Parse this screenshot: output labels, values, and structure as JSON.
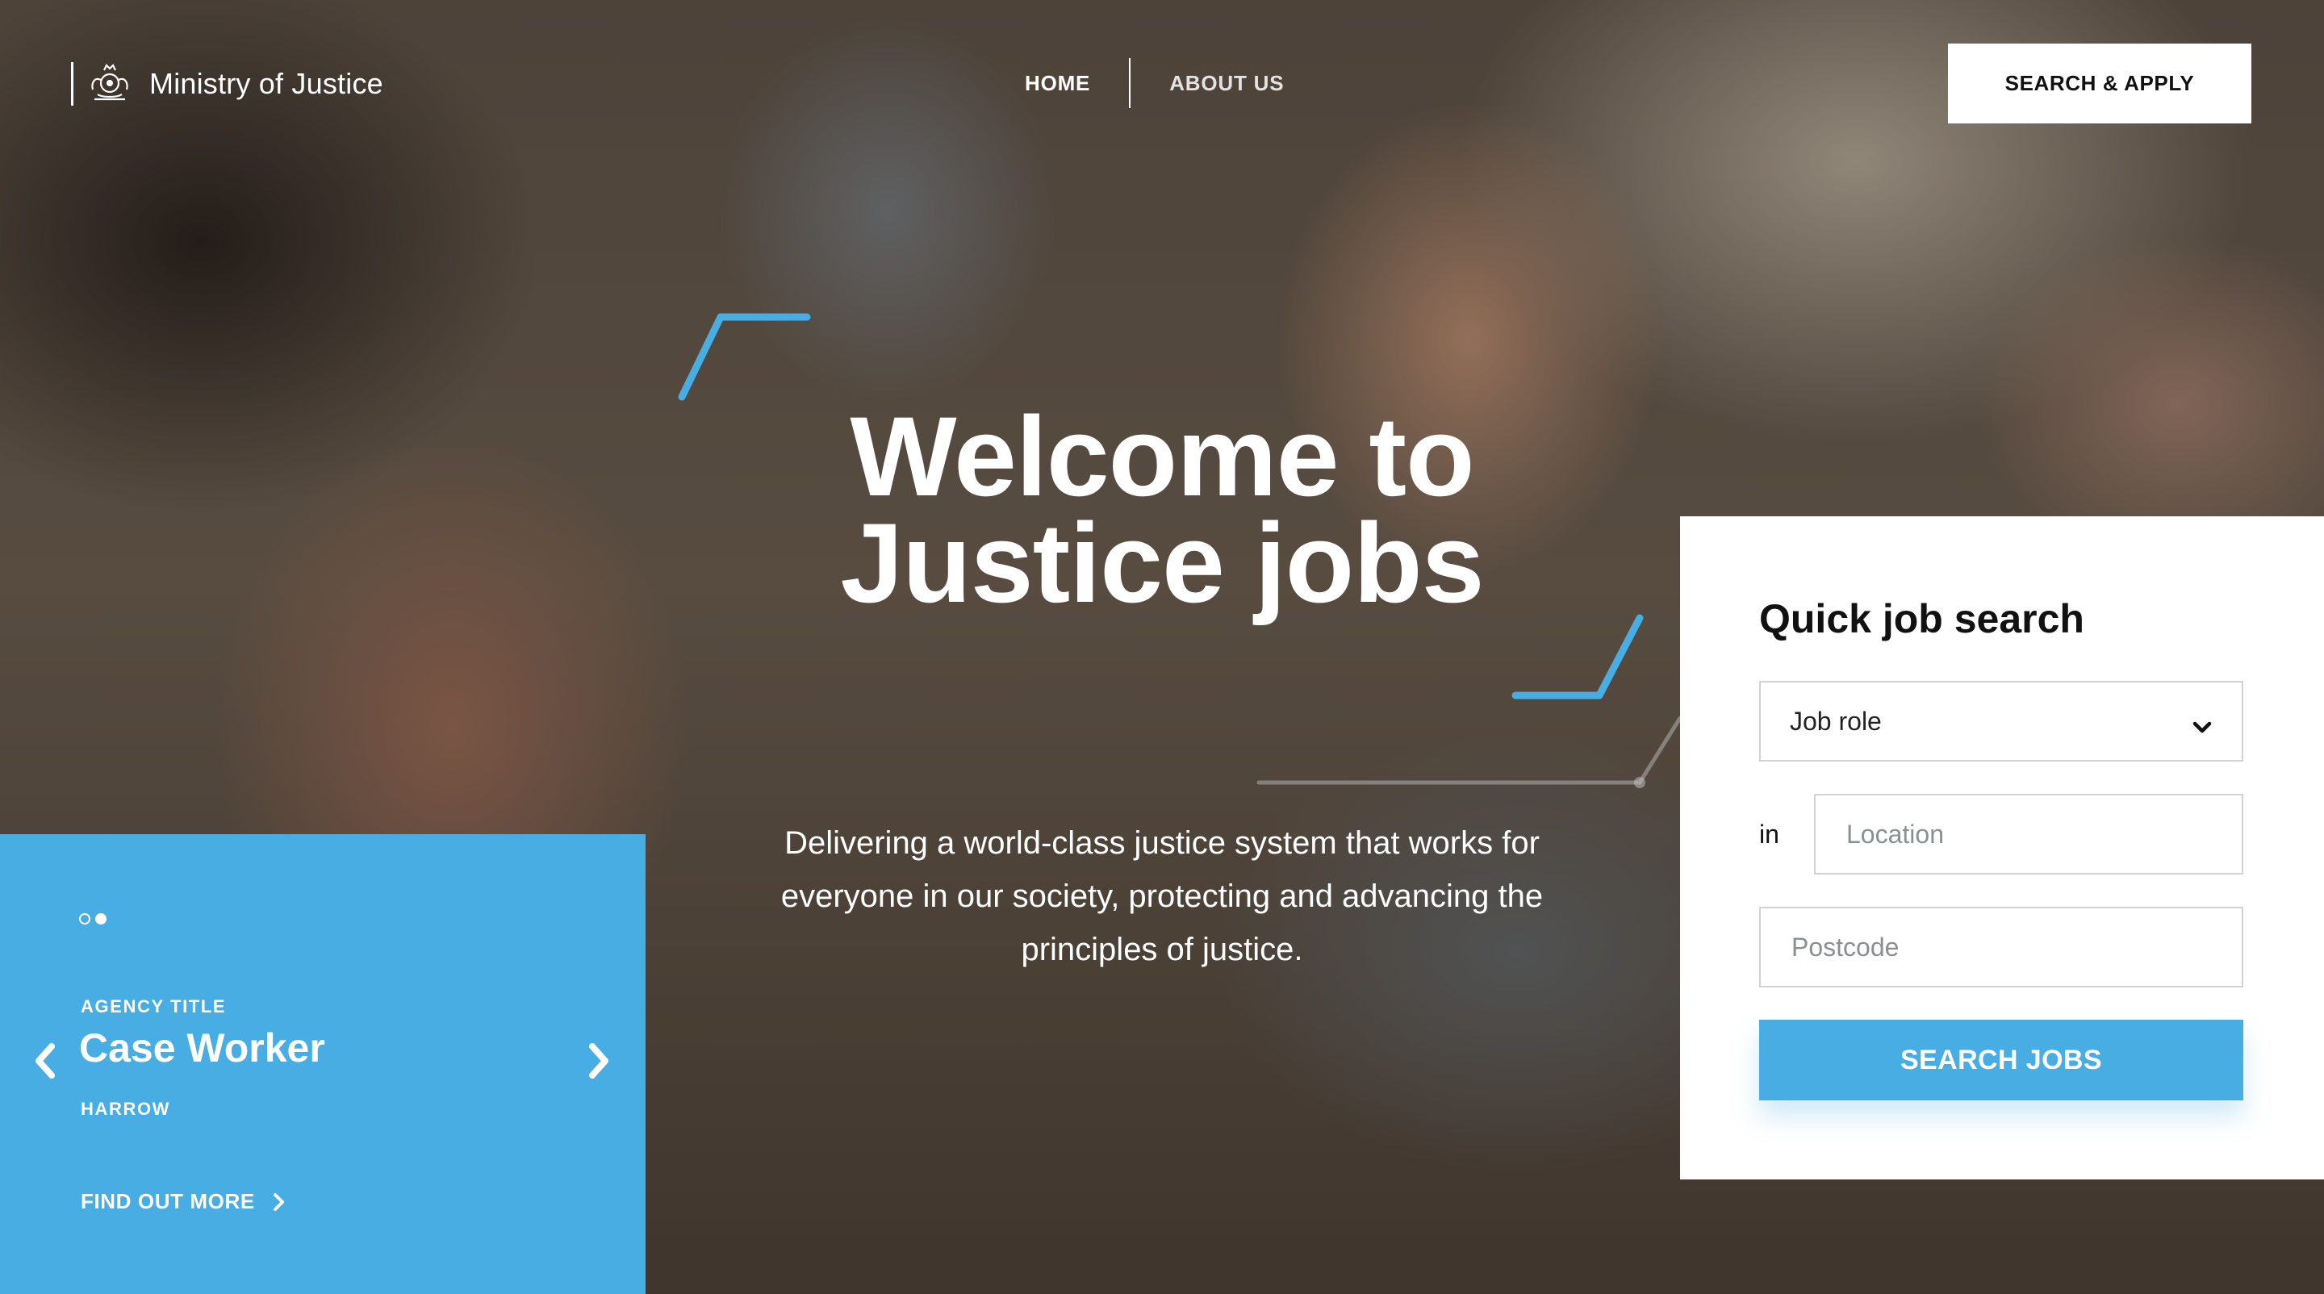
{
  "header": {
    "org_name": "Ministry of Justice",
    "nav": [
      {
        "label": "HOME"
      },
      {
        "label": "ABOUT US"
      }
    ],
    "cta_label": "SEARCH & APPLY"
  },
  "hero": {
    "title_line1": "Welcome to",
    "title_line2": "Justice jobs",
    "subtitle_line1": "Delivering a world-class justice system that works for",
    "subtitle_line2": "everyone in our society, protecting and advancing the",
    "subtitle_line3": "principles of justice."
  },
  "carousel": {
    "slide_count": 2,
    "active_slide": 2,
    "agency": "AGENCY TITLE",
    "job_title": "Case Worker",
    "location": "HARROW",
    "link_label": "FIND OUT MORE"
  },
  "search": {
    "title": "Quick job search",
    "job_role_value": "Job role",
    "in_label": "in",
    "location_placeholder": "Location",
    "postcode_placeholder": "Postcode",
    "button_label": "SEARCH JOBS"
  },
  "colors": {
    "accent_blue": "#48ade3",
    "text_dark": "#111111",
    "white": "#ffffff"
  },
  "icons": {
    "logo": "royal-crest-icon",
    "select": "chevron-down-icon",
    "prev": "chevron-left-icon",
    "next": "chevron-right-icon",
    "link": "chevron-right-icon"
  }
}
